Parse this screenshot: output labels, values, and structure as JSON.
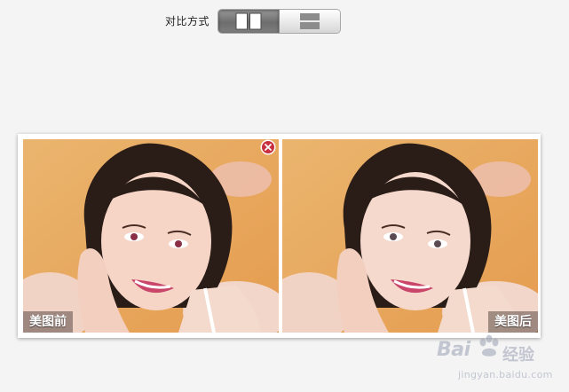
{
  "toolbar": {
    "mode_label": "对比方式",
    "modes": [
      {
        "id": "side-by-side",
        "icon": "split-vertical-icon",
        "active": true
      },
      {
        "id": "top-bottom",
        "icon": "split-horizontal-icon",
        "active": false
      }
    ]
  },
  "compare": {
    "before_label": "美图前",
    "after_label": "美图后",
    "close_icon": "close-icon"
  },
  "watermark": {
    "brand": "Bai",
    "brand_suffix": "经验",
    "url": "jingyan.baidu.com",
    "icon": "paw-icon"
  },
  "colors": {
    "background": "#f4f4f4",
    "photo_backdrop": "#e8a85e",
    "close_red": "#c9303f"
  }
}
